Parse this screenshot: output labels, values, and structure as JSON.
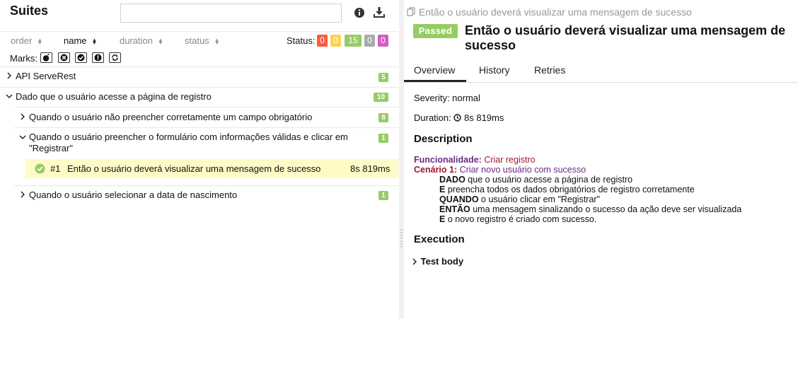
{
  "left": {
    "title": "Suites",
    "search": {
      "value": "",
      "placeholder": ""
    },
    "icons": {
      "info": "info-icon",
      "download": "download-icon"
    },
    "sort": {
      "order": "order",
      "name": "name",
      "duration": "duration",
      "status": "status"
    },
    "status_label": "Status:",
    "status_counts": [
      {
        "key": "failed",
        "value": "0",
        "color": "#fd5a3e"
      },
      {
        "key": "broken",
        "value": "0",
        "color": "#ffd050"
      },
      {
        "key": "passed",
        "value": "15",
        "color": "#97cc64"
      },
      {
        "key": "skipped",
        "value": "0",
        "color": "#aaaaaa"
      },
      {
        "key": "unknown",
        "value": "0",
        "color": "#d35ebe"
      }
    ],
    "marks_label": "Marks:",
    "marks": [
      "flaky-icon",
      "new-failed-icon",
      "new-passed-icon",
      "new-broken-icon",
      "retries-icon"
    ],
    "tree": {
      "item1": {
        "label": "API ServeRest",
        "count": "5"
      },
      "item2": {
        "label": "Dado que o usuário acesse a página de registro",
        "count": "10"
      },
      "item2a": {
        "label": "Quando o usuário não preencher corretamente um campo obrigatório",
        "count": "8"
      },
      "item2b": {
        "line1": "Quando o usuário preencher o formulário com informações válidas e clicar em",
        "line2": "\"Registrar\"",
        "count": "1"
      },
      "test": {
        "number": "#1",
        "label": "Então o usuário deverá visualizar uma mensagem de sucesso",
        "duration": "8s 819ms"
      },
      "item2c": {
        "label": "Quando o usuário selecionar a data de nascimento",
        "count": "1"
      }
    }
  },
  "right": {
    "breadcrumb": "Então o usuário deverá visualizar uma mensagem de sucesso",
    "status": "Passed",
    "title": "Então o usuário deverá visualizar uma mensagem de sucesso",
    "tabs": {
      "overview": "Overview",
      "history": "History",
      "retries": "Retries"
    },
    "severity": "Severity: normal",
    "duration_label": "Duration:",
    "duration_value": "8s 819ms",
    "description_heading": "Description",
    "description": {
      "feature_kw": "Funcionalidade:",
      "feature": "Criar registro",
      "scenario_kw": "Cenário 1:",
      "scenario": "Criar novo usuário com sucesso",
      "steps": [
        {
          "kw": "DADO",
          "text": "que o usuário acesse a página de registro"
        },
        {
          "kw": "E",
          "text": "preencha todos os dados obrigatórios de registro corretamente"
        },
        {
          "kw": "QUANDO",
          "text": "o usuário clicar em \"Registrar\""
        },
        {
          "kw": "ENTÃO",
          "text": "uma mensagem sinalizando o sucesso da ação deve ser visualizada"
        },
        {
          "kw": "E",
          "text": "o novo registro é criado com sucesso."
        }
      ]
    },
    "execution_heading": "Execution",
    "test_body": "Test body"
  }
}
